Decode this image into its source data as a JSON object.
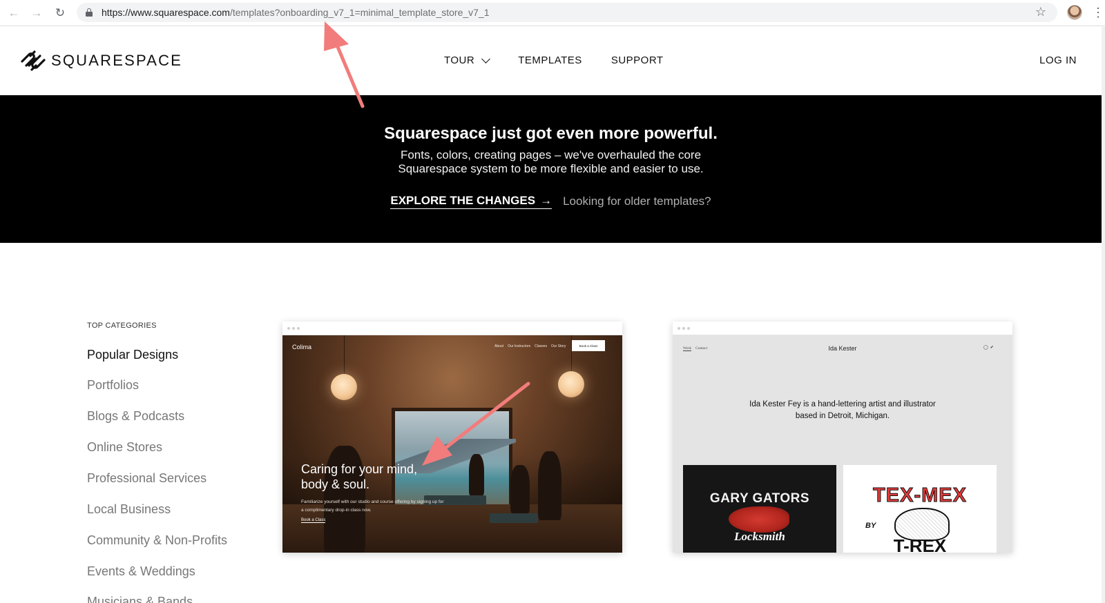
{
  "browser": {
    "url_host": "https://www.squarespace.com",
    "url_path": "/templates?onboarding_v7_1=minimal_template_store_v7_1",
    "back_icon": "arrow-left-icon",
    "forward_icon": "arrow-right-icon",
    "reload_icon": "reload-icon"
  },
  "header": {
    "logo_text": "SQUARESPACE",
    "nav": [
      {
        "label": "TOUR"
      },
      {
        "label": "TEMPLATES"
      },
      {
        "label": "SUPPORT"
      }
    ],
    "login_label": "LOG IN"
  },
  "promo": {
    "title": "Squarespace just got even more powerful.",
    "text_line1": "Fonts, colors, creating pages – we've overhauled the core",
    "text_line2": "Squarespace system to be more flexible and easier to use.",
    "explore_label": "EXPLORE THE CHANGES",
    "older_label": "Looking for older templates?"
  },
  "sidebar": {
    "heading": "TOP CATEGORIES",
    "items": [
      {
        "label": "Popular Designs",
        "active": true
      },
      {
        "label": "Portfolios"
      },
      {
        "label": "Blogs & Podcasts"
      },
      {
        "label": "Online Stores"
      },
      {
        "label": "Professional Services"
      },
      {
        "label": "Local Business"
      },
      {
        "label": "Community & Non-Profits"
      },
      {
        "label": "Events & Weddings"
      },
      {
        "label": "Musicians & Bands"
      }
    ]
  },
  "templates": [
    {
      "brand": "Colima",
      "nav": [
        "About",
        "Our Instructors",
        "Classes",
        "Our Story"
      ],
      "button": "Book a Class",
      "headline_line1": "Caring for your mind,",
      "headline_line2": "body & soul.",
      "sub": "Familiarize yourself with our studio and course offering by signing up for a complimentary drop-in class now.",
      "cta": "Book a Class"
    },
    {
      "nav": [
        "Work",
        "Contact"
      ],
      "site_name": "Ida Kester",
      "intro_line1": "Ida Kester Fey is a hand-lettering artist and illustrator",
      "intro_line2": "based in Detroit, Michigan.",
      "tile1_title": "GARY GATORS",
      "tile1_sub": "Locksmith",
      "tile2_title": "TEX-MEX",
      "tile2_by": "BY",
      "tile2_bottom": "T-REX"
    }
  ],
  "colors": {
    "annotation_arrow": "#f27c7c",
    "promo_bg": "#000000"
  }
}
